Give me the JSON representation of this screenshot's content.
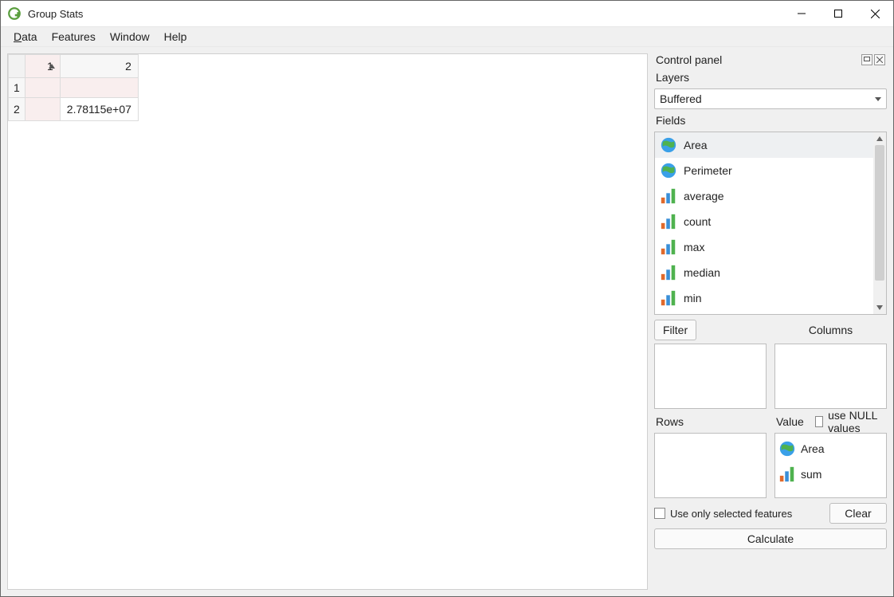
{
  "window": {
    "title": "Group Stats"
  },
  "menu": {
    "data": "Data",
    "features": "Features",
    "window": "Window",
    "help": "Help"
  },
  "table": {
    "col1": "1",
    "col2": "2",
    "row1": "1",
    "row2": "2",
    "r1c1": "",
    "r1c2": "",
    "r2c1": "",
    "r2c2": "2.78115e+07"
  },
  "panel": {
    "title": "Control panel",
    "layers_label": "Layers",
    "layer_selected": "Buffered",
    "fields_label": "Fields",
    "fields": {
      "area": "Area",
      "perimeter": "Perimeter",
      "average": "average",
      "count": "count",
      "max": "max",
      "median": "median",
      "min": "min"
    },
    "filter_btn": "Filter",
    "columns_label": "Columns",
    "rows_label": "Rows",
    "value_label": "Value",
    "use_null": "use NULL values",
    "value_items": {
      "area": "Area",
      "sum": "sum"
    },
    "use_selected": "Use only selected features",
    "clear_btn": "Clear",
    "calculate_btn": "Calculate"
  }
}
